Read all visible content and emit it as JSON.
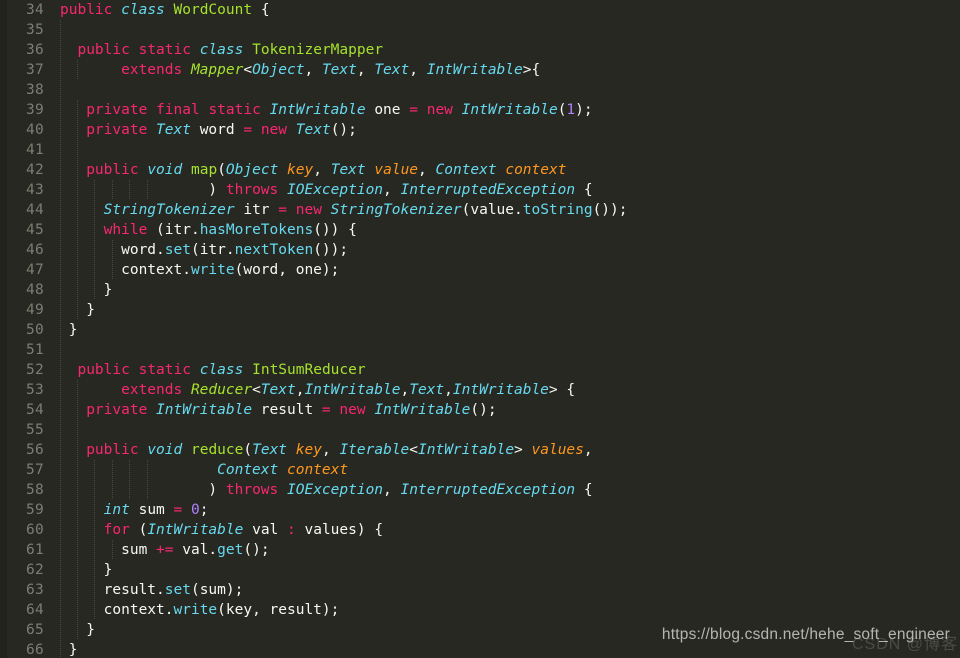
{
  "editor": {
    "first_line_number": 34,
    "last_line_number": 66,
    "background_color": "#272822",
    "gutter_color": "#7b7e71",
    "default_text_color": "#f8f8f2",
    "language": "java",
    "palette": {
      "keyword": "#f92672",
      "type": "#66d9ef",
      "class_name": "#a6e22e",
      "function": "#a6e22e",
      "method_call": "#66d9ef",
      "parameter": "#fd971f",
      "number": "#ae81ff",
      "plain": "#f8f8f2"
    }
  },
  "watermark": {
    "url_text": "https://blog.csdn.net/hehe_soft_engineer",
    "logo_text": "CSDN @博客"
  },
  "lines": [
    {
      "n": "34",
      "indent": 0,
      "tokens": [
        {
          "t": "public",
          "c": "t-key"
        },
        {
          "t": " ",
          "c": "t-pl"
        },
        {
          "t": "class",
          "c": "t-type"
        },
        {
          "t": " ",
          "c": "t-pl"
        },
        {
          "t": "WordCount",
          "c": "t-cls"
        },
        {
          "t": " {",
          "c": "t-pl"
        }
      ]
    },
    {
      "n": "35",
      "indent": 1,
      "tokens": []
    },
    {
      "n": "36",
      "indent": 1,
      "tokens": [
        {
          "t": "  ",
          "c": "t-pl"
        },
        {
          "t": "public",
          "c": "t-key"
        },
        {
          "t": " ",
          "c": "t-pl"
        },
        {
          "t": "static",
          "c": "t-key"
        },
        {
          "t": " ",
          "c": "t-pl"
        },
        {
          "t": "class",
          "c": "t-type"
        },
        {
          "t": " ",
          "c": "t-pl"
        },
        {
          "t": "TokenizerMapper",
          "c": "t-cls"
        }
      ]
    },
    {
      "n": "37",
      "indent": 2,
      "tokens": [
        {
          "t": "       ",
          "c": "t-pl"
        },
        {
          "t": "extends",
          "c": "t-key"
        },
        {
          "t": " ",
          "c": "t-pl"
        },
        {
          "t": "Mapper",
          "c": "t-clsi"
        },
        {
          "t": "<",
          "c": "t-pl"
        },
        {
          "t": "Object",
          "c": "t-type"
        },
        {
          "t": ", ",
          "c": "t-pl"
        },
        {
          "t": "Text",
          "c": "t-type"
        },
        {
          "t": ", ",
          "c": "t-pl"
        },
        {
          "t": "Text",
          "c": "t-type"
        },
        {
          "t": ", ",
          "c": "t-pl"
        },
        {
          "t": "IntWritable",
          "c": "t-type"
        },
        {
          "t": ">{",
          "c": "t-pl"
        }
      ]
    },
    {
      "n": "38",
      "indent": 1,
      "tokens": []
    },
    {
      "n": "39",
      "indent": 2,
      "tokens": [
        {
          "t": "   ",
          "c": "t-pl"
        },
        {
          "t": "private",
          "c": "t-key"
        },
        {
          "t": " ",
          "c": "t-pl"
        },
        {
          "t": "final",
          "c": "t-key"
        },
        {
          "t": " ",
          "c": "t-pl"
        },
        {
          "t": "static",
          "c": "t-key"
        },
        {
          "t": " ",
          "c": "t-pl"
        },
        {
          "t": "IntWritable",
          "c": "t-type"
        },
        {
          "t": " one ",
          "c": "t-pl"
        },
        {
          "t": "=",
          "c": "t-op"
        },
        {
          "t": " ",
          "c": "t-pl"
        },
        {
          "t": "new",
          "c": "t-key"
        },
        {
          "t": " ",
          "c": "t-pl"
        },
        {
          "t": "IntWritable",
          "c": "t-type"
        },
        {
          "t": "(",
          "c": "t-pl"
        },
        {
          "t": "1",
          "c": "t-num"
        },
        {
          "t": ");",
          "c": "t-pl"
        }
      ]
    },
    {
      "n": "40",
      "indent": 2,
      "tokens": [
        {
          "t": "   ",
          "c": "t-pl"
        },
        {
          "t": "private",
          "c": "t-key"
        },
        {
          "t": " ",
          "c": "t-pl"
        },
        {
          "t": "Text",
          "c": "t-type"
        },
        {
          "t": " word ",
          "c": "t-pl"
        },
        {
          "t": "=",
          "c": "t-op"
        },
        {
          "t": " ",
          "c": "t-pl"
        },
        {
          "t": "new",
          "c": "t-key"
        },
        {
          "t": " ",
          "c": "t-pl"
        },
        {
          "t": "Text",
          "c": "t-type"
        },
        {
          "t": "();",
          "c": "t-pl"
        }
      ]
    },
    {
      "n": "41",
      "indent": 2,
      "tokens": []
    },
    {
      "n": "42",
      "indent": 2,
      "tokens": [
        {
          "t": "   ",
          "c": "t-pl"
        },
        {
          "t": "public",
          "c": "t-key"
        },
        {
          "t": " ",
          "c": "t-pl"
        },
        {
          "t": "void",
          "c": "t-type"
        },
        {
          "t": " ",
          "c": "t-pl"
        },
        {
          "t": "map",
          "c": "t-fn"
        },
        {
          "t": "(",
          "c": "t-pl"
        },
        {
          "t": "Object",
          "c": "t-type"
        },
        {
          "t": " ",
          "c": "t-pl"
        },
        {
          "t": "key",
          "c": "t-param"
        },
        {
          "t": ", ",
          "c": "t-pl"
        },
        {
          "t": "Text",
          "c": "t-type"
        },
        {
          "t": " ",
          "c": "t-pl"
        },
        {
          "t": "value",
          "c": "t-param"
        },
        {
          "t": ", ",
          "c": "t-pl"
        },
        {
          "t": "Context",
          "c": "t-type"
        },
        {
          "t": " ",
          "c": "t-pl"
        },
        {
          "t": "context",
          "c": "t-param"
        }
      ]
    },
    {
      "n": "43",
      "indent": 6,
      "tokens": [
        {
          "t": "                 ",
          "c": "t-pl"
        },
        {
          "t": ")",
          "c": "t-pl"
        },
        {
          "t": " ",
          "c": "t-pl"
        },
        {
          "t": "throws",
          "c": "t-key"
        },
        {
          "t": " ",
          "c": "t-pl"
        },
        {
          "t": "IOException",
          "c": "t-type"
        },
        {
          "t": ", ",
          "c": "t-pl"
        },
        {
          "t": "InterruptedException",
          "c": "t-type"
        },
        {
          "t": " {",
          "c": "t-pl"
        }
      ]
    },
    {
      "n": "44",
      "indent": 3,
      "tokens": [
        {
          "t": "     ",
          "c": "t-pl"
        },
        {
          "t": "StringTokenizer",
          "c": "t-type"
        },
        {
          "t": " itr ",
          "c": "t-pl"
        },
        {
          "t": "=",
          "c": "t-op"
        },
        {
          "t": " ",
          "c": "t-pl"
        },
        {
          "t": "new",
          "c": "t-key"
        },
        {
          "t": " ",
          "c": "t-pl"
        },
        {
          "t": "StringTokenizer",
          "c": "t-type"
        },
        {
          "t": "(value.",
          "c": "t-pl"
        },
        {
          "t": "toString",
          "c": "t-call"
        },
        {
          "t": "());",
          "c": "t-pl"
        }
      ]
    },
    {
      "n": "45",
      "indent": 3,
      "tokens": [
        {
          "t": "     ",
          "c": "t-pl"
        },
        {
          "t": "while",
          "c": "t-key"
        },
        {
          "t": " (itr.",
          "c": "t-pl"
        },
        {
          "t": "hasMoreTokens",
          "c": "t-call"
        },
        {
          "t": "()) {",
          "c": "t-pl"
        }
      ]
    },
    {
      "n": "46",
      "indent": 4,
      "tokens": [
        {
          "t": "       ",
          "c": "t-pl"
        },
        {
          "t": "word.",
          "c": "t-pl"
        },
        {
          "t": "set",
          "c": "t-call"
        },
        {
          "t": "(itr.",
          "c": "t-pl"
        },
        {
          "t": "nextToken",
          "c": "t-call"
        },
        {
          "t": "());",
          "c": "t-pl"
        }
      ]
    },
    {
      "n": "47",
      "indent": 4,
      "tokens": [
        {
          "t": "       ",
          "c": "t-pl"
        },
        {
          "t": "context.",
          "c": "t-pl"
        },
        {
          "t": "write",
          "c": "t-call"
        },
        {
          "t": "(word, one);",
          "c": "t-pl"
        }
      ]
    },
    {
      "n": "48",
      "indent": 3,
      "tokens": [
        {
          "t": "     }",
          "c": "t-pl"
        }
      ]
    },
    {
      "n": "49",
      "indent": 2,
      "tokens": [
        {
          "t": "   }",
          "c": "t-pl"
        }
      ]
    },
    {
      "n": "50",
      "indent": 1,
      "tokens": [
        {
          "t": " }",
          "c": "t-pl"
        }
      ]
    },
    {
      "n": "51",
      "indent": 1,
      "tokens": []
    },
    {
      "n": "52",
      "indent": 1,
      "tokens": [
        {
          "t": "  ",
          "c": "t-pl"
        },
        {
          "t": "public",
          "c": "t-key"
        },
        {
          "t": " ",
          "c": "t-pl"
        },
        {
          "t": "static",
          "c": "t-key"
        },
        {
          "t": " ",
          "c": "t-pl"
        },
        {
          "t": "class",
          "c": "t-type"
        },
        {
          "t": " ",
          "c": "t-pl"
        },
        {
          "t": "IntSumReducer",
          "c": "t-cls"
        }
      ]
    },
    {
      "n": "53",
      "indent": 2,
      "tokens": [
        {
          "t": "       ",
          "c": "t-pl"
        },
        {
          "t": "extends",
          "c": "t-key"
        },
        {
          "t": " ",
          "c": "t-pl"
        },
        {
          "t": "Reducer",
          "c": "t-clsi"
        },
        {
          "t": "<",
          "c": "t-pl"
        },
        {
          "t": "Text",
          "c": "t-type"
        },
        {
          "t": ",",
          "c": "t-pl"
        },
        {
          "t": "IntWritable",
          "c": "t-type"
        },
        {
          "t": ",",
          "c": "t-pl"
        },
        {
          "t": "Text",
          "c": "t-type"
        },
        {
          "t": ",",
          "c": "t-pl"
        },
        {
          "t": "IntWritable",
          "c": "t-type"
        },
        {
          "t": "> {",
          "c": "t-pl"
        }
      ]
    },
    {
      "n": "54",
      "indent": 2,
      "tokens": [
        {
          "t": "   ",
          "c": "t-pl"
        },
        {
          "t": "private",
          "c": "t-key"
        },
        {
          "t": " ",
          "c": "t-pl"
        },
        {
          "t": "IntWritable",
          "c": "t-type"
        },
        {
          "t": " result ",
          "c": "t-pl"
        },
        {
          "t": "=",
          "c": "t-op"
        },
        {
          "t": " ",
          "c": "t-pl"
        },
        {
          "t": "new",
          "c": "t-key"
        },
        {
          "t": " ",
          "c": "t-pl"
        },
        {
          "t": "IntWritable",
          "c": "t-type"
        },
        {
          "t": "();",
          "c": "t-pl"
        }
      ]
    },
    {
      "n": "55",
      "indent": 2,
      "tokens": []
    },
    {
      "n": "56",
      "indent": 2,
      "tokens": [
        {
          "t": "   ",
          "c": "t-pl"
        },
        {
          "t": "public",
          "c": "t-key"
        },
        {
          "t": " ",
          "c": "t-pl"
        },
        {
          "t": "void",
          "c": "t-type"
        },
        {
          "t": " ",
          "c": "t-pl"
        },
        {
          "t": "reduce",
          "c": "t-fn"
        },
        {
          "t": "(",
          "c": "t-pl"
        },
        {
          "t": "Text",
          "c": "t-type"
        },
        {
          "t": " ",
          "c": "t-pl"
        },
        {
          "t": "key",
          "c": "t-param"
        },
        {
          "t": ", ",
          "c": "t-pl"
        },
        {
          "t": "Iterable",
          "c": "t-type"
        },
        {
          "t": "<",
          "c": "t-pl"
        },
        {
          "t": "IntWritable",
          "c": "t-type"
        },
        {
          "t": "> ",
          "c": "t-pl"
        },
        {
          "t": "values",
          "c": "t-param"
        },
        {
          "t": ",",
          "c": "t-pl"
        }
      ]
    },
    {
      "n": "57",
      "indent": 6,
      "tokens": [
        {
          "t": "                  ",
          "c": "t-pl"
        },
        {
          "t": "Context",
          "c": "t-type"
        },
        {
          "t": " ",
          "c": "t-pl"
        },
        {
          "t": "context",
          "c": "t-param"
        }
      ]
    },
    {
      "n": "58",
      "indent": 6,
      "tokens": [
        {
          "t": "                 ",
          "c": "t-pl"
        },
        {
          "t": ")",
          "c": "t-pl"
        },
        {
          "t": " ",
          "c": "t-pl"
        },
        {
          "t": "throws",
          "c": "t-key"
        },
        {
          "t": " ",
          "c": "t-pl"
        },
        {
          "t": "IOException",
          "c": "t-type"
        },
        {
          "t": ", ",
          "c": "t-pl"
        },
        {
          "t": "InterruptedException",
          "c": "t-type"
        },
        {
          "t": " {",
          "c": "t-pl"
        }
      ]
    },
    {
      "n": "59",
      "indent": 3,
      "tokens": [
        {
          "t": "     ",
          "c": "t-pl"
        },
        {
          "t": "int",
          "c": "t-type"
        },
        {
          "t": " sum ",
          "c": "t-pl"
        },
        {
          "t": "=",
          "c": "t-op"
        },
        {
          "t": " ",
          "c": "t-pl"
        },
        {
          "t": "0",
          "c": "t-num"
        },
        {
          "t": ";",
          "c": "t-pl"
        }
      ]
    },
    {
      "n": "60",
      "indent": 3,
      "tokens": [
        {
          "t": "     ",
          "c": "t-pl"
        },
        {
          "t": "for",
          "c": "t-key"
        },
        {
          "t": " (",
          "c": "t-pl"
        },
        {
          "t": "IntWritable",
          "c": "t-type"
        },
        {
          "t": " val ",
          "c": "t-pl"
        },
        {
          "t": ":",
          "c": "t-op"
        },
        {
          "t": " values) {",
          "c": "t-pl"
        }
      ]
    },
    {
      "n": "61",
      "indent": 4,
      "tokens": [
        {
          "t": "       ",
          "c": "t-pl"
        },
        {
          "t": "sum ",
          "c": "t-pl"
        },
        {
          "t": "+=",
          "c": "t-op"
        },
        {
          "t": " val.",
          "c": "t-pl"
        },
        {
          "t": "get",
          "c": "t-call"
        },
        {
          "t": "();",
          "c": "t-pl"
        }
      ]
    },
    {
      "n": "62",
      "indent": 3,
      "tokens": [
        {
          "t": "     }",
          "c": "t-pl"
        }
      ]
    },
    {
      "n": "63",
      "indent": 3,
      "tokens": [
        {
          "t": "     ",
          "c": "t-pl"
        },
        {
          "t": "result.",
          "c": "t-pl"
        },
        {
          "t": "set",
          "c": "t-call"
        },
        {
          "t": "(sum);",
          "c": "t-pl"
        }
      ]
    },
    {
      "n": "64",
      "indent": 3,
      "tokens": [
        {
          "t": "     ",
          "c": "t-pl"
        },
        {
          "t": "context.",
          "c": "t-pl"
        },
        {
          "t": "write",
          "c": "t-call"
        },
        {
          "t": "(key, result);",
          "c": "t-pl"
        }
      ]
    },
    {
      "n": "65",
      "indent": 2,
      "tokens": [
        {
          "t": "   }",
          "c": "t-pl"
        }
      ]
    },
    {
      "n": "66",
      "indent": 1,
      "tokens": [
        {
          "t": " }",
          "c": "t-pl"
        }
      ]
    }
  ]
}
